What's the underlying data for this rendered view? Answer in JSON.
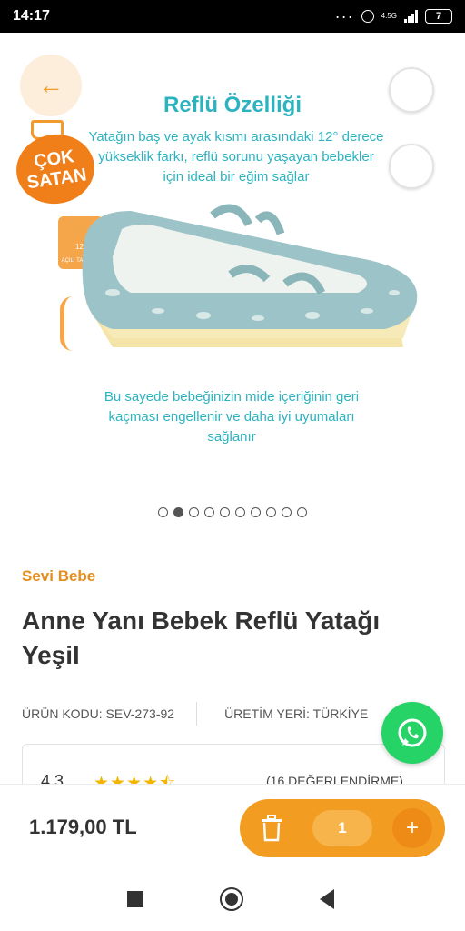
{
  "status_bar": {
    "time": "14:17",
    "network": "4.5G",
    "battery": "7"
  },
  "gallery": {
    "slide_title": "Reflü Özelliği",
    "slide_description": "Yatağın baş ve ayak kısmı arasındaki 12° derece yükseklik farkı, reflü sorunu yaşayan bebekler için ideal bir eğim sağlar",
    "slide_footer": "Bu sayede bebeğinizin mide içeriğinin geri kaçması engellenir ve daha iyi uyumaları sağlanır",
    "badge_line1": "ÇOK",
    "badge_line2": "SATAN",
    "feature_tag_degree": "12°",
    "feature_tag_label": "AÇILI TASARIM",
    "page_count": 10,
    "active_index": 1
  },
  "product": {
    "brand": "Sevi Bebe",
    "title": "Anne Yanı Bebek Reflü Yatağı Yeşil",
    "code": "ÜRÜN KODU: SEV-273-92",
    "origin": "ÜRETİM YERİ: TÜRKİYE",
    "rating": "4.3",
    "stars": "★★★★⯪",
    "review_count": "(16 DEĞERLENDİRME)"
  },
  "purchase": {
    "price": "1.179,00 TL",
    "quantity": "1",
    "plus_label": "+"
  },
  "colors": {
    "accent_orange": "#f39c22",
    "teal_text": "#2bb3c0",
    "whatsapp_green": "#25d366"
  }
}
